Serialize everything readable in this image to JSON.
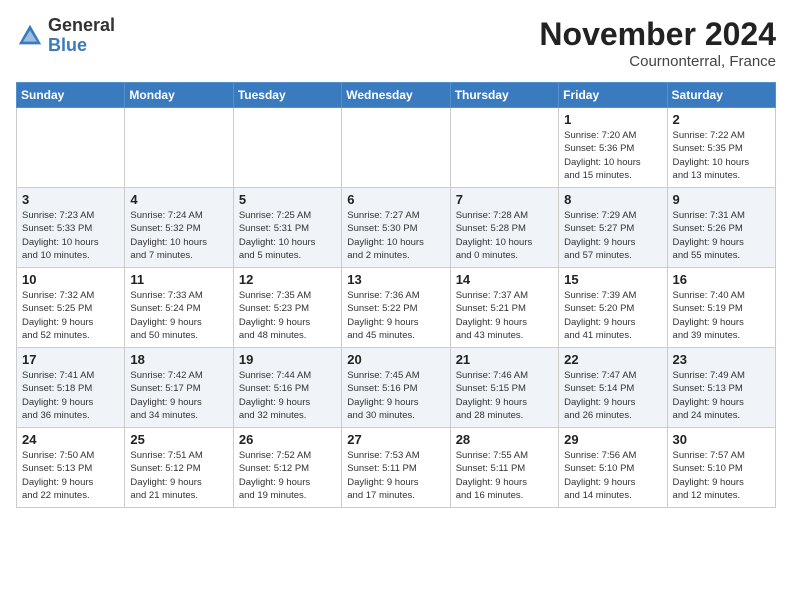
{
  "logo": {
    "general": "General",
    "blue": "Blue"
  },
  "header": {
    "month": "November 2024",
    "location": "Cournonterral, France"
  },
  "weekdays": [
    "Sunday",
    "Monday",
    "Tuesday",
    "Wednesday",
    "Thursday",
    "Friday",
    "Saturday"
  ],
  "weeks": [
    [
      {
        "day": "",
        "info": ""
      },
      {
        "day": "",
        "info": ""
      },
      {
        "day": "",
        "info": ""
      },
      {
        "day": "",
        "info": ""
      },
      {
        "day": "",
        "info": ""
      },
      {
        "day": "1",
        "info": "Sunrise: 7:20 AM\nSunset: 5:36 PM\nDaylight: 10 hours\nand 15 minutes."
      },
      {
        "day": "2",
        "info": "Sunrise: 7:22 AM\nSunset: 5:35 PM\nDaylight: 10 hours\nand 13 minutes."
      }
    ],
    [
      {
        "day": "3",
        "info": "Sunrise: 7:23 AM\nSunset: 5:33 PM\nDaylight: 10 hours\nand 10 minutes."
      },
      {
        "day": "4",
        "info": "Sunrise: 7:24 AM\nSunset: 5:32 PM\nDaylight: 10 hours\nand 7 minutes."
      },
      {
        "day": "5",
        "info": "Sunrise: 7:25 AM\nSunset: 5:31 PM\nDaylight: 10 hours\nand 5 minutes."
      },
      {
        "day": "6",
        "info": "Sunrise: 7:27 AM\nSunset: 5:30 PM\nDaylight: 10 hours\nand 2 minutes."
      },
      {
        "day": "7",
        "info": "Sunrise: 7:28 AM\nSunset: 5:28 PM\nDaylight: 10 hours\nand 0 minutes."
      },
      {
        "day": "8",
        "info": "Sunrise: 7:29 AM\nSunset: 5:27 PM\nDaylight: 9 hours\nand 57 minutes."
      },
      {
        "day": "9",
        "info": "Sunrise: 7:31 AM\nSunset: 5:26 PM\nDaylight: 9 hours\nand 55 minutes."
      }
    ],
    [
      {
        "day": "10",
        "info": "Sunrise: 7:32 AM\nSunset: 5:25 PM\nDaylight: 9 hours\nand 52 minutes."
      },
      {
        "day": "11",
        "info": "Sunrise: 7:33 AM\nSunset: 5:24 PM\nDaylight: 9 hours\nand 50 minutes."
      },
      {
        "day": "12",
        "info": "Sunrise: 7:35 AM\nSunset: 5:23 PM\nDaylight: 9 hours\nand 48 minutes."
      },
      {
        "day": "13",
        "info": "Sunrise: 7:36 AM\nSunset: 5:22 PM\nDaylight: 9 hours\nand 45 minutes."
      },
      {
        "day": "14",
        "info": "Sunrise: 7:37 AM\nSunset: 5:21 PM\nDaylight: 9 hours\nand 43 minutes."
      },
      {
        "day": "15",
        "info": "Sunrise: 7:39 AM\nSunset: 5:20 PM\nDaylight: 9 hours\nand 41 minutes."
      },
      {
        "day": "16",
        "info": "Sunrise: 7:40 AM\nSunset: 5:19 PM\nDaylight: 9 hours\nand 39 minutes."
      }
    ],
    [
      {
        "day": "17",
        "info": "Sunrise: 7:41 AM\nSunset: 5:18 PM\nDaylight: 9 hours\nand 36 minutes."
      },
      {
        "day": "18",
        "info": "Sunrise: 7:42 AM\nSunset: 5:17 PM\nDaylight: 9 hours\nand 34 minutes."
      },
      {
        "day": "19",
        "info": "Sunrise: 7:44 AM\nSunset: 5:16 PM\nDaylight: 9 hours\nand 32 minutes."
      },
      {
        "day": "20",
        "info": "Sunrise: 7:45 AM\nSunset: 5:16 PM\nDaylight: 9 hours\nand 30 minutes."
      },
      {
        "day": "21",
        "info": "Sunrise: 7:46 AM\nSunset: 5:15 PM\nDaylight: 9 hours\nand 28 minutes."
      },
      {
        "day": "22",
        "info": "Sunrise: 7:47 AM\nSunset: 5:14 PM\nDaylight: 9 hours\nand 26 minutes."
      },
      {
        "day": "23",
        "info": "Sunrise: 7:49 AM\nSunset: 5:13 PM\nDaylight: 9 hours\nand 24 minutes."
      }
    ],
    [
      {
        "day": "24",
        "info": "Sunrise: 7:50 AM\nSunset: 5:13 PM\nDaylight: 9 hours\nand 22 minutes."
      },
      {
        "day": "25",
        "info": "Sunrise: 7:51 AM\nSunset: 5:12 PM\nDaylight: 9 hours\nand 21 minutes."
      },
      {
        "day": "26",
        "info": "Sunrise: 7:52 AM\nSunset: 5:12 PM\nDaylight: 9 hours\nand 19 minutes."
      },
      {
        "day": "27",
        "info": "Sunrise: 7:53 AM\nSunset: 5:11 PM\nDaylight: 9 hours\nand 17 minutes."
      },
      {
        "day": "28",
        "info": "Sunrise: 7:55 AM\nSunset: 5:11 PM\nDaylight: 9 hours\nand 16 minutes."
      },
      {
        "day": "29",
        "info": "Sunrise: 7:56 AM\nSunset: 5:10 PM\nDaylight: 9 hours\nand 14 minutes."
      },
      {
        "day": "30",
        "info": "Sunrise: 7:57 AM\nSunset: 5:10 PM\nDaylight: 9 hours\nand 12 minutes."
      }
    ]
  ]
}
